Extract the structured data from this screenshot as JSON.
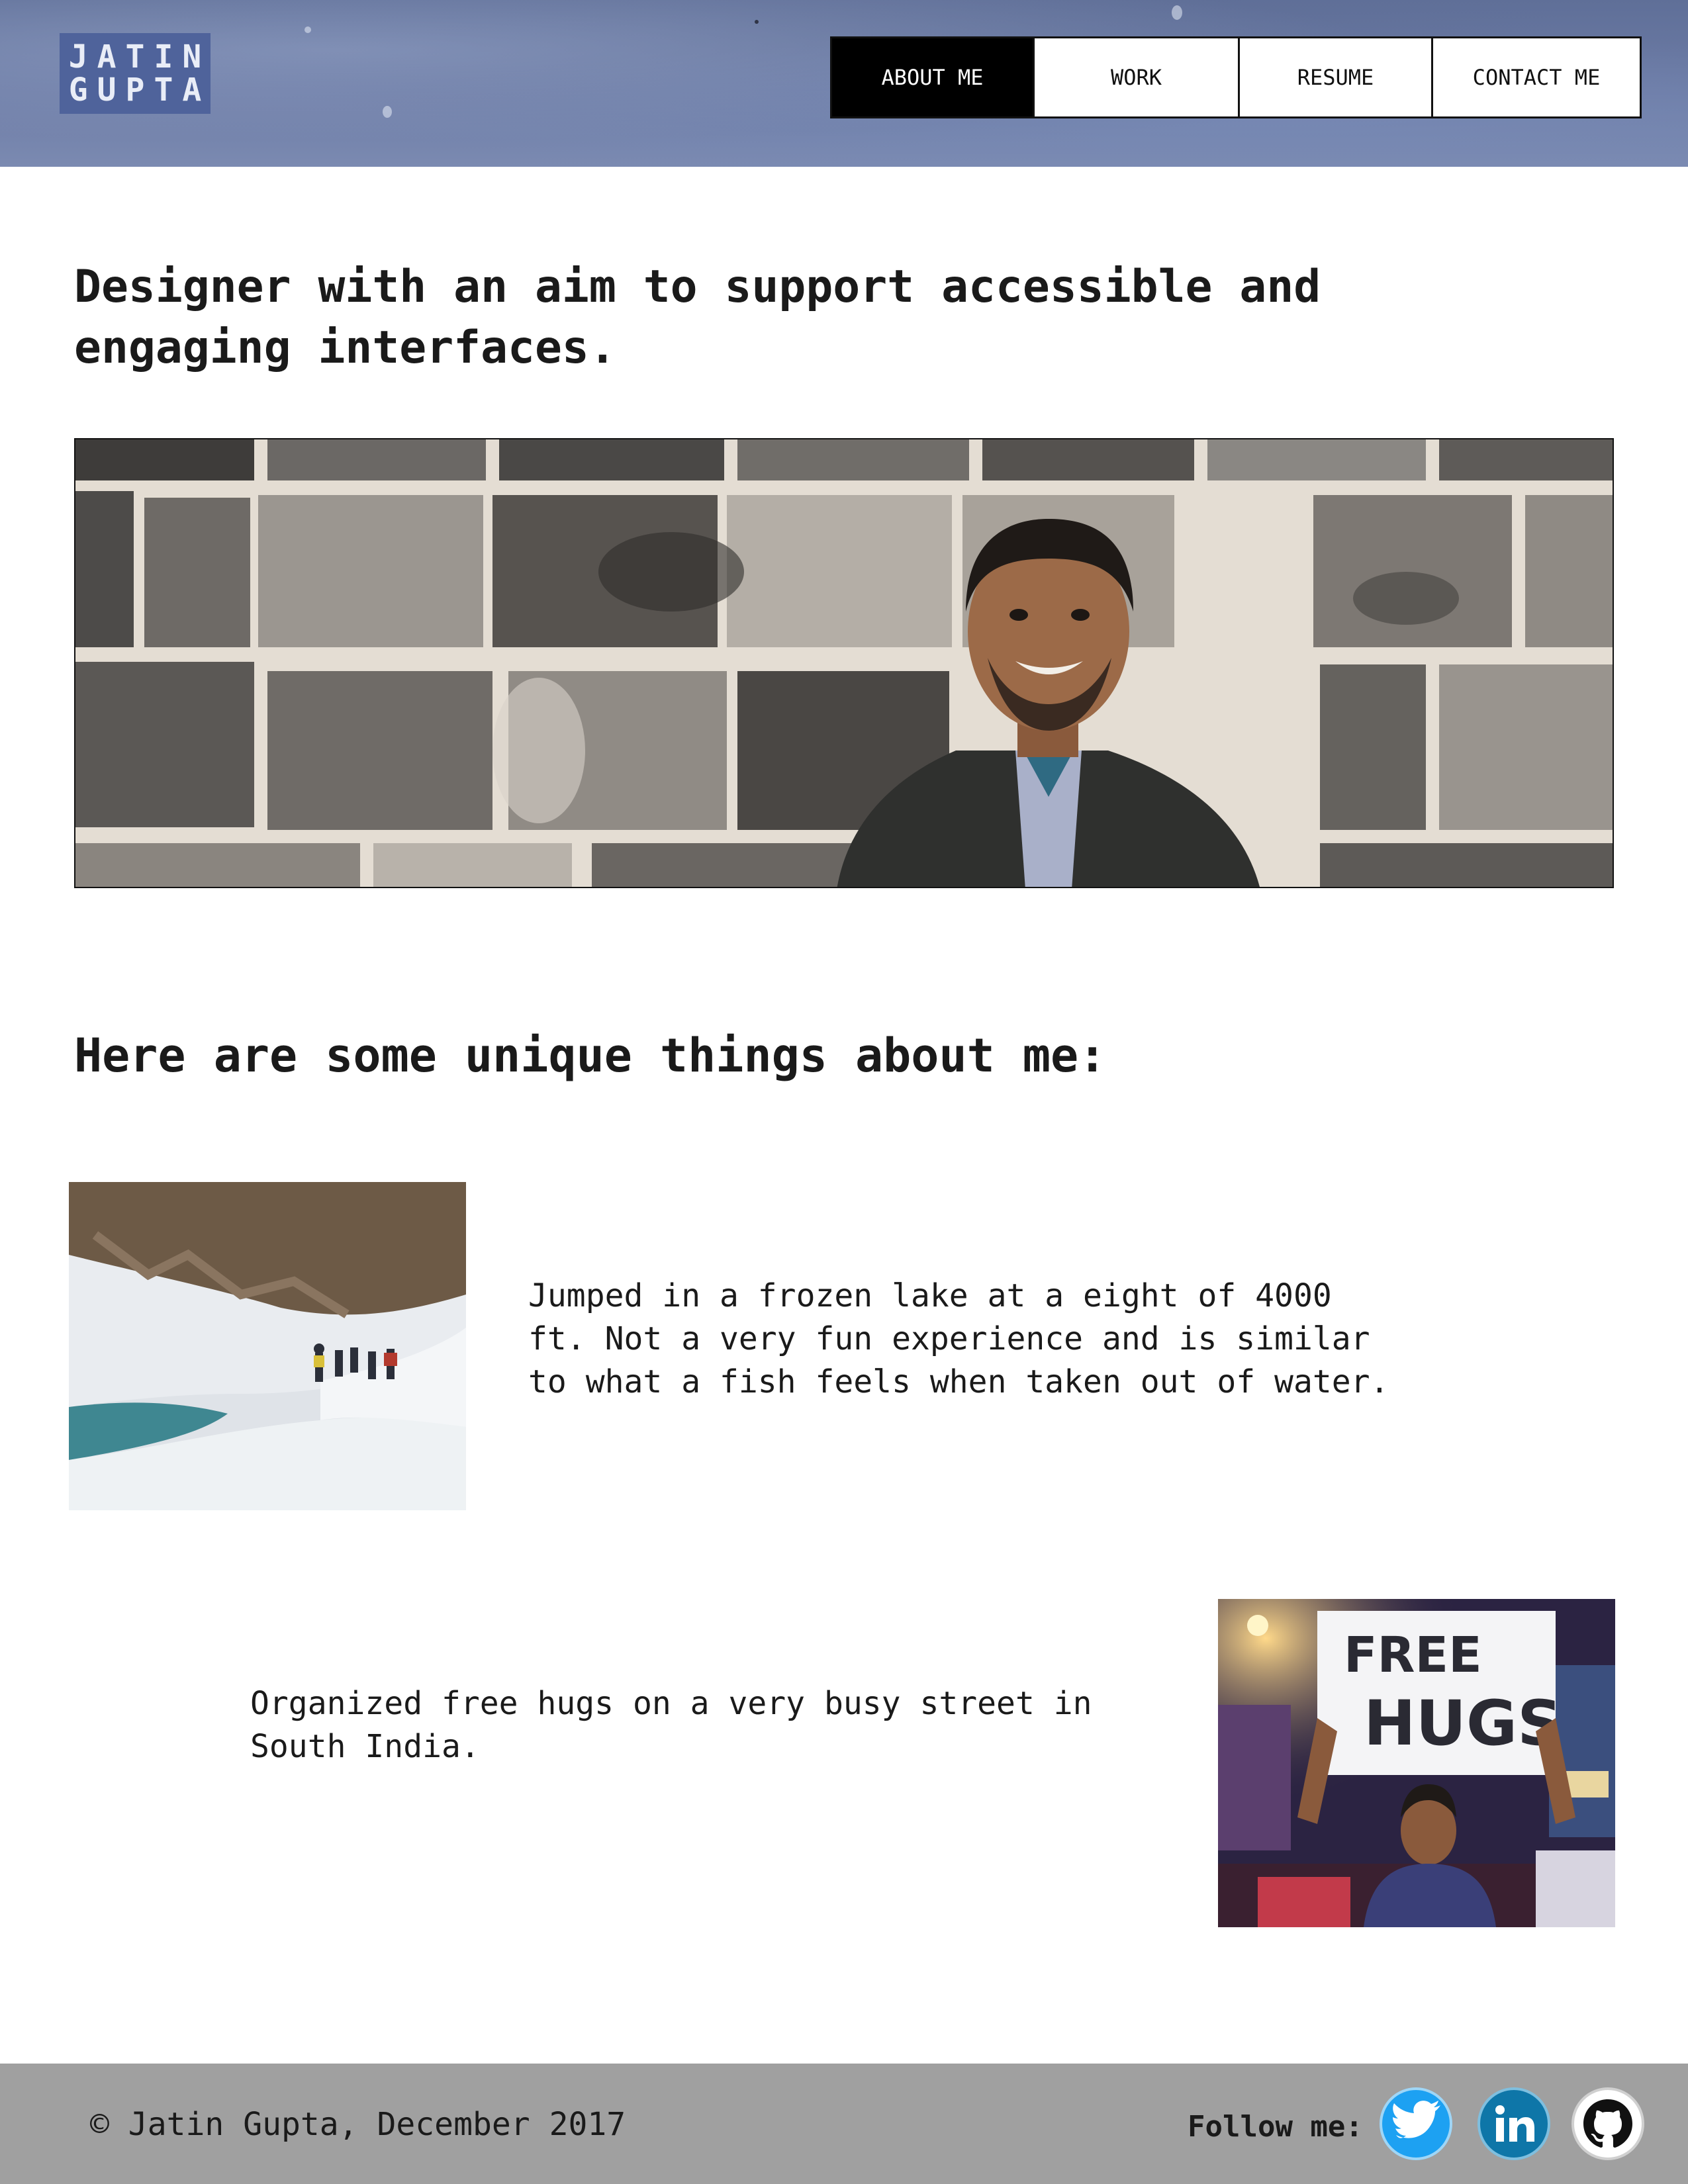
{
  "header": {
    "logo_line1": "JATIN",
    "logo_line2": "GUPTA",
    "nav": [
      "ABOUT ME",
      "WORK",
      "RESUME",
      "CONTACT ME"
    ]
  },
  "main": {
    "tagline": "Designer with an aim to support accessible and\nengaging interfaces.",
    "section_title": "Here are some unique things about me:",
    "stories": [
      {
        "text": "Jumped in a frozen lake at a eight of 4000\nft. Not a very fun experience and is similar\nto what a fish feels when taken out of water."
      },
      {
        "text": "Organized free hugs on a very busy street in\nSouth India.",
        "sign_line1": "FREE",
        "sign_line2": "HUGS"
      }
    ]
  },
  "footer": {
    "copyright": "© Jatin Gupta, December 2017",
    "follow_label": "Follow me:"
  },
  "colors": {
    "header_blue": "#5f6f98",
    "logo_bg": "#4f639b",
    "nav_active_bg": "#000000",
    "footer_bg": "#a0a0a0",
    "twitter": "#1da1f2",
    "linkedin": "#0e76a8",
    "github": "#111111"
  },
  "icons": [
    "twitter-icon",
    "linkedin-icon",
    "github-icon"
  ]
}
